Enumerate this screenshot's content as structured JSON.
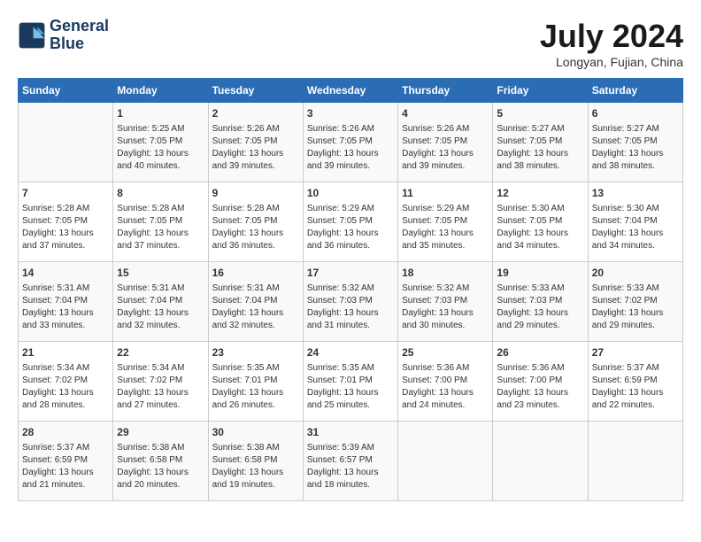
{
  "header": {
    "logo_line1": "General",
    "logo_line2": "Blue",
    "month_title": "July 2024",
    "location": "Longyan, Fujian, China"
  },
  "days_of_week": [
    "Sunday",
    "Monday",
    "Tuesday",
    "Wednesday",
    "Thursday",
    "Friday",
    "Saturday"
  ],
  "weeks": [
    [
      {
        "day": "",
        "info": ""
      },
      {
        "day": "1",
        "info": "Sunrise: 5:25 AM\nSunset: 7:05 PM\nDaylight: 13 hours\nand 40 minutes."
      },
      {
        "day": "2",
        "info": "Sunrise: 5:26 AM\nSunset: 7:05 PM\nDaylight: 13 hours\nand 39 minutes."
      },
      {
        "day": "3",
        "info": "Sunrise: 5:26 AM\nSunset: 7:05 PM\nDaylight: 13 hours\nand 39 minutes."
      },
      {
        "day": "4",
        "info": "Sunrise: 5:26 AM\nSunset: 7:05 PM\nDaylight: 13 hours\nand 39 minutes."
      },
      {
        "day": "5",
        "info": "Sunrise: 5:27 AM\nSunset: 7:05 PM\nDaylight: 13 hours\nand 38 minutes."
      },
      {
        "day": "6",
        "info": "Sunrise: 5:27 AM\nSunset: 7:05 PM\nDaylight: 13 hours\nand 38 minutes."
      }
    ],
    [
      {
        "day": "7",
        "info": "Sunrise: 5:28 AM\nSunset: 7:05 PM\nDaylight: 13 hours\nand 37 minutes."
      },
      {
        "day": "8",
        "info": "Sunrise: 5:28 AM\nSunset: 7:05 PM\nDaylight: 13 hours\nand 37 minutes."
      },
      {
        "day": "9",
        "info": "Sunrise: 5:28 AM\nSunset: 7:05 PM\nDaylight: 13 hours\nand 36 minutes."
      },
      {
        "day": "10",
        "info": "Sunrise: 5:29 AM\nSunset: 7:05 PM\nDaylight: 13 hours\nand 36 minutes."
      },
      {
        "day": "11",
        "info": "Sunrise: 5:29 AM\nSunset: 7:05 PM\nDaylight: 13 hours\nand 35 minutes."
      },
      {
        "day": "12",
        "info": "Sunrise: 5:30 AM\nSunset: 7:05 PM\nDaylight: 13 hours\nand 34 minutes."
      },
      {
        "day": "13",
        "info": "Sunrise: 5:30 AM\nSunset: 7:04 PM\nDaylight: 13 hours\nand 34 minutes."
      }
    ],
    [
      {
        "day": "14",
        "info": "Sunrise: 5:31 AM\nSunset: 7:04 PM\nDaylight: 13 hours\nand 33 minutes."
      },
      {
        "day": "15",
        "info": "Sunrise: 5:31 AM\nSunset: 7:04 PM\nDaylight: 13 hours\nand 32 minutes."
      },
      {
        "day": "16",
        "info": "Sunrise: 5:31 AM\nSunset: 7:04 PM\nDaylight: 13 hours\nand 32 minutes."
      },
      {
        "day": "17",
        "info": "Sunrise: 5:32 AM\nSunset: 7:03 PM\nDaylight: 13 hours\nand 31 minutes."
      },
      {
        "day": "18",
        "info": "Sunrise: 5:32 AM\nSunset: 7:03 PM\nDaylight: 13 hours\nand 30 minutes."
      },
      {
        "day": "19",
        "info": "Sunrise: 5:33 AM\nSunset: 7:03 PM\nDaylight: 13 hours\nand 29 minutes."
      },
      {
        "day": "20",
        "info": "Sunrise: 5:33 AM\nSunset: 7:02 PM\nDaylight: 13 hours\nand 29 minutes."
      }
    ],
    [
      {
        "day": "21",
        "info": "Sunrise: 5:34 AM\nSunset: 7:02 PM\nDaylight: 13 hours\nand 28 minutes."
      },
      {
        "day": "22",
        "info": "Sunrise: 5:34 AM\nSunset: 7:02 PM\nDaylight: 13 hours\nand 27 minutes."
      },
      {
        "day": "23",
        "info": "Sunrise: 5:35 AM\nSunset: 7:01 PM\nDaylight: 13 hours\nand 26 minutes."
      },
      {
        "day": "24",
        "info": "Sunrise: 5:35 AM\nSunset: 7:01 PM\nDaylight: 13 hours\nand 25 minutes."
      },
      {
        "day": "25",
        "info": "Sunrise: 5:36 AM\nSunset: 7:00 PM\nDaylight: 13 hours\nand 24 minutes."
      },
      {
        "day": "26",
        "info": "Sunrise: 5:36 AM\nSunset: 7:00 PM\nDaylight: 13 hours\nand 23 minutes."
      },
      {
        "day": "27",
        "info": "Sunrise: 5:37 AM\nSunset: 6:59 PM\nDaylight: 13 hours\nand 22 minutes."
      }
    ],
    [
      {
        "day": "28",
        "info": "Sunrise: 5:37 AM\nSunset: 6:59 PM\nDaylight: 13 hours\nand 21 minutes."
      },
      {
        "day": "29",
        "info": "Sunrise: 5:38 AM\nSunset: 6:58 PM\nDaylight: 13 hours\nand 20 minutes."
      },
      {
        "day": "30",
        "info": "Sunrise: 5:38 AM\nSunset: 6:58 PM\nDaylight: 13 hours\nand 19 minutes."
      },
      {
        "day": "31",
        "info": "Sunrise: 5:39 AM\nSunset: 6:57 PM\nDaylight: 13 hours\nand 18 minutes."
      },
      {
        "day": "",
        "info": ""
      },
      {
        "day": "",
        "info": ""
      },
      {
        "day": "",
        "info": ""
      }
    ]
  ]
}
